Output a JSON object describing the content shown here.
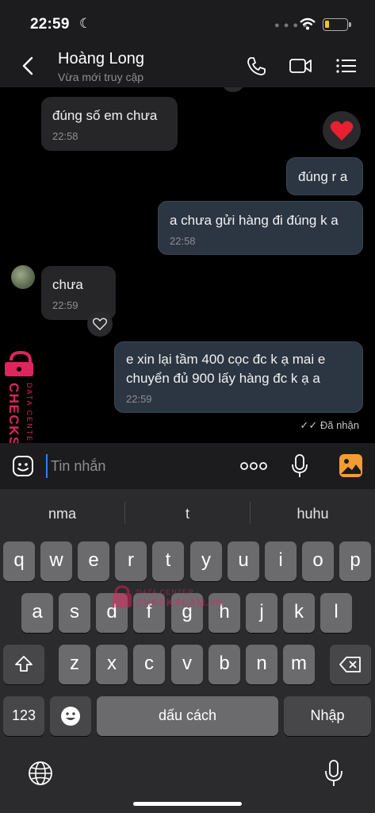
{
  "status_bar": {
    "time": "22:59",
    "moon_icon": "moon-icon",
    "wifi_icon": "wifi-icon",
    "battery_icon": "battery-icon",
    "battery_color": "#f5c518"
  },
  "header": {
    "contact_name": "Hoàng Long",
    "contact_status": "Vừa mới truy cập",
    "icons": [
      "back-chevron-icon",
      "phone-icon",
      "video-call-icon",
      "menu-list-icon"
    ]
  },
  "messages": [
    {
      "direction": "in",
      "text": "đúng số em chưa",
      "time": "22:58"
    },
    {
      "direction": "out",
      "text": "đúng r a"
    },
    {
      "direction": "out",
      "text": "a chưa gửi hàng đi đúng k a",
      "time": "22:58"
    },
    {
      "direction": "in",
      "text": "chưa",
      "time": "22:59"
    },
    {
      "direction": "out",
      "text": "e xin lại tầm 400 cọc đc k ạ mai e chuyển đủ 900 lấy hàng đc k ạ a",
      "time": "22:59"
    }
  ],
  "reactions": {
    "heart": "heart-reaction-icon",
    "like": "heart-outline-icon"
  },
  "delivery_status": "Đã nhận",
  "watermark": {
    "side_line1": "DATA CENTER",
    "side_line2": "CHECKSCAM.VN",
    "center_line1": "DATA CENTER",
    "center_line2": "CHECKSCAM.VN",
    "color": "#e0245e"
  },
  "input": {
    "placeholder": "Tin nhắn"
  },
  "keyboard": {
    "suggestions": [
      "nma",
      "t",
      "huhu"
    ],
    "row1": [
      "q",
      "w",
      "e",
      "r",
      "t",
      "y",
      "u",
      "i",
      "o",
      "p"
    ],
    "row2": [
      "a",
      "s",
      "d",
      "f",
      "g",
      "h",
      "j",
      "k",
      "l"
    ],
    "row3": [
      "z",
      "x",
      "c",
      "v",
      "b",
      "n",
      "m"
    ],
    "numbers_key": "123",
    "space_key": "dấu cách",
    "return_key": "Nhập"
  },
  "colors": {
    "accent": "#2f7ff5",
    "outgoing_bubble": "#2c3542",
    "incoming_bubble": "#262628",
    "gallery_orange": "#f39c33"
  }
}
